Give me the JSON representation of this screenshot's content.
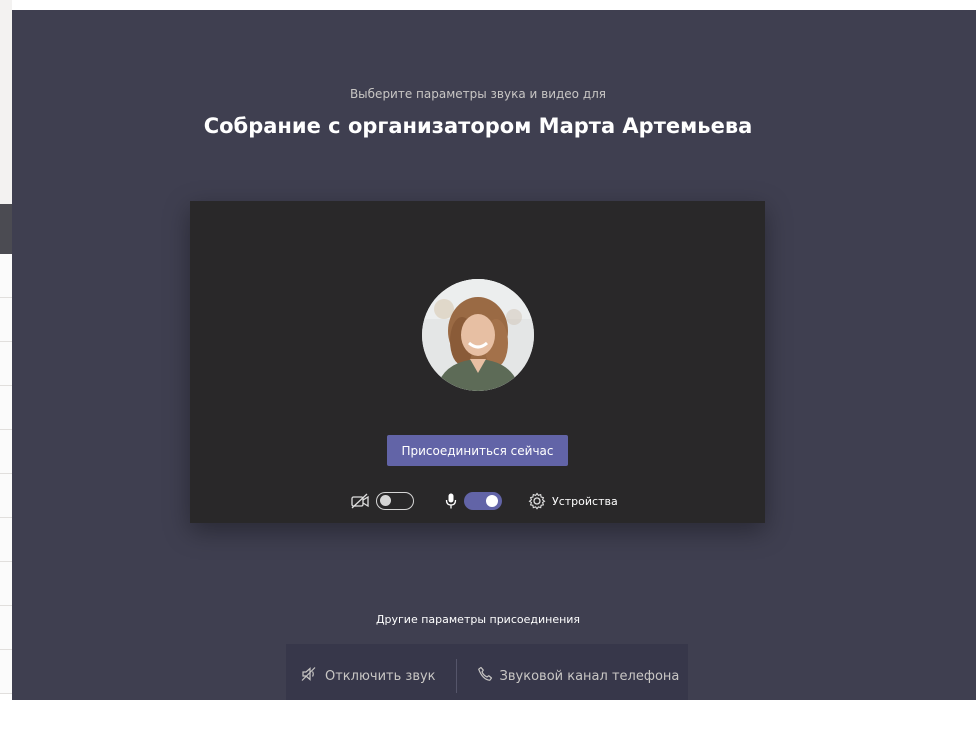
{
  "prejoin": {
    "subtitle": "Выберите параметры звука и видео для",
    "meeting_title": "Собрание с организатором Марта Артемьева",
    "join_button": "Присоединиться сейчас",
    "camera": {
      "icon": "camera-off-icon",
      "enabled": false
    },
    "microphone": {
      "icon": "microphone-icon",
      "enabled": true
    },
    "devices_label": "Устройства"
  },
  "other_options": {
    "heading": "Другие параметры присоединения",
    "mute_label": "Отключить звук",
    "phone_label": "Звуковой канал телефона"
  },
  "colors": {
    "background": "#3f3f50",
    "preview": "#292829",
    "accent": "#6264a7"
  }
}
